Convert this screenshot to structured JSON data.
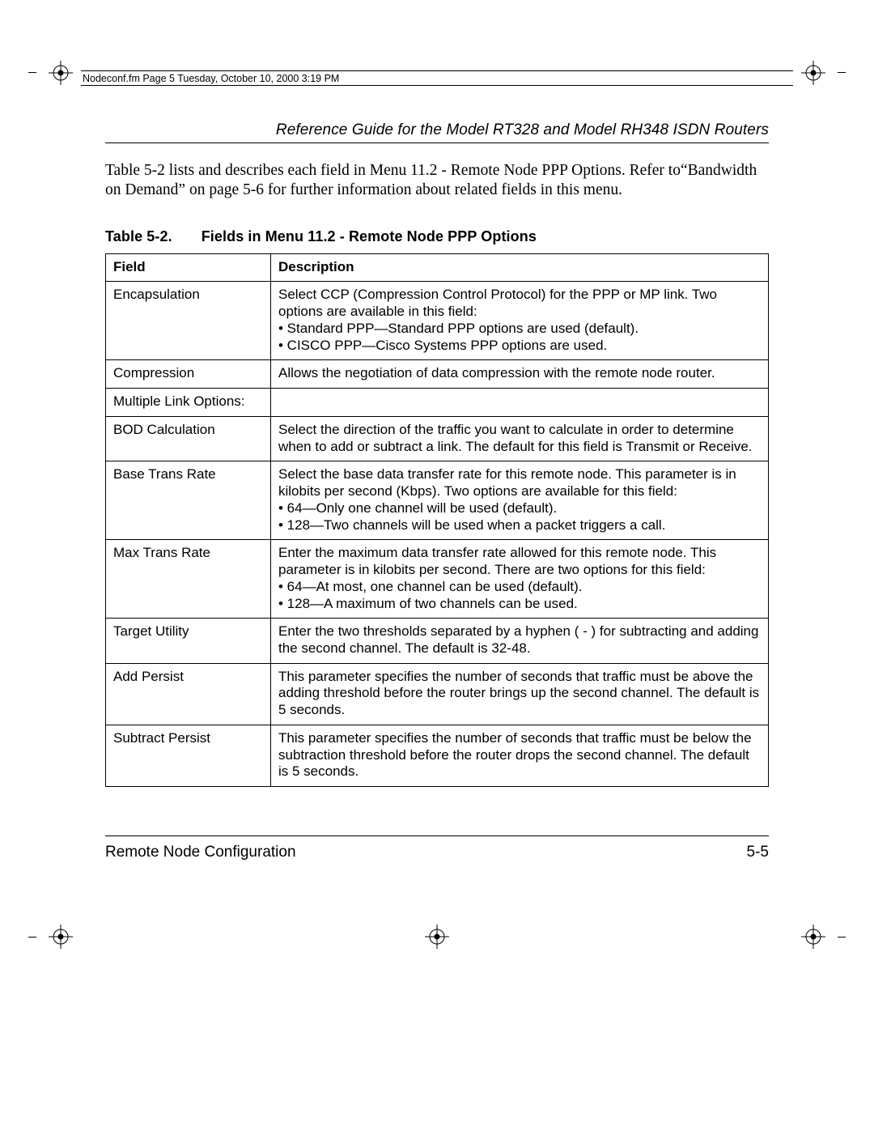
{
  "print_header": "Nodeconf.fm  Page 5  Tuesday, October 10, 2000  3:19 PM",
  "doc_title": "Reference Guide for the Model RT328 and Model RH348 ISDN Routers",
  "intro": "Table 5-2 lists and describes each field in Menu 11.2 - Remote Node PPP Options. Refer to“Bandwidth on Demand” on page 5-6 for further information about related fields in this menu.",
  "table": {
    "caption_label": "Table 5-2.",
    "caption_title": "Fields in Menu 11.2 - Remote Node PPP Options",
    "headers": {
      "field": "Field",
      "description": "Description"
    },
    "rows": [
      {
        "field": "Encapsulation",
        "description": "Select CCP (Compression Control Protocol) for the PPP or MP link. Two options are available in this field:\n• Standard PPP—Standard PPP options are used (default).\n• CISCO PPP—Cisco Systems PPP options are used."
      },
      {
        "field": "Compression",
        "description": "Allows the negotiation of data compression with the remote node router."
      },
      {
        "field": "Multiple Link Options:",
        "description": "",
        "sub": [
          {
            "field": "BOD Calculation",
            "description": "Select the direction of the traffic you want to calculate in order to determine when to add or subtract a link. The default for this field is Transmit or Receive."
          },
          {
            "field": "Base Trans Rate",
            "description": "Select the base data transfer rate for this remote node. This parameter is in kilobits per second (Kbps). Two options are available for this field:\n• 64—Only one channel will be used (default).\n• 128—Two channels will be used when a packet triggers a call."
          },
          {
            "field": "Max Trans Rate",
            "description": "Enter the maximum data transfer rate allowed for this remote node. This parameter is in kilobits per second. There are two options for this field:\n• 64—At most, one channel can be used (default).\n• 128—A maximum of two channels can be used."
          },
          {
            "field": "Target Utility",
            "description": "Enter the two thresholds separated by a hyphen ( - ) for subtracting and adding the second channel. The default is 32-48."
          },
          {
            "field": "Add Persist",
            "description": "This parameter specifies the number of seconds that traffic must be above the adding threshold before the router brings up the second channel. The default is 5 seconds."
          },
          {
            "field": "Subtract Persist",
            "description": "This parameter specifies the number of seconds that traffic must be below the subtraction threshold before the router drops the second channel. The default is 5 seconds."
          }
        ]
      }
    ]
  },
  "footer": {
    "left": "Remote Node Configuration",
    "right": "5-5"
  }
}
